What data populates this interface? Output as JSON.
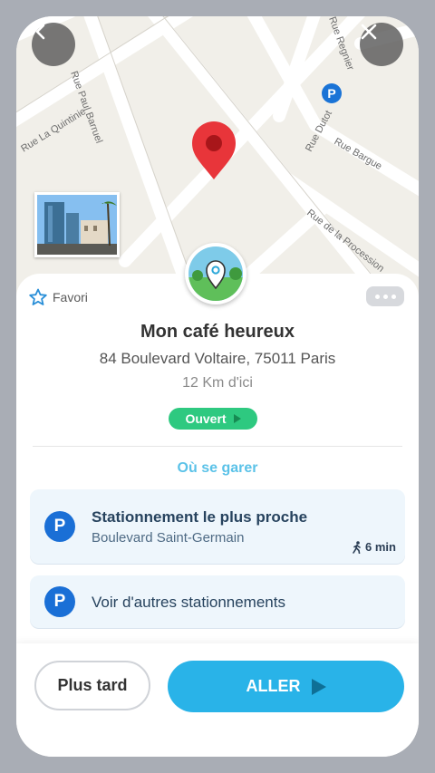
{
  "map": {
    "streets": [
      "Rue La Quintinie",
      "Rue Paul Barruel",
      "Rue Dutot",
      "Rue Bargue",
      "Rue de la Procession",
      "Rue Regnier"
    ],
    "parking_marker": "P"
  },
  "buttons": {
    "back_icon": "chevron-left-icon",
    "close_icon": "close-icon"
  },
  "place": {
    "favorite_label": "Favori",
    "name": "Mon café heureux",
    "address": "84 Boulevard Voltaire, 75011 Paris",
    "distance": "12 Km d'ici",
    "status": "Ouvert",
    "status_color": "#2ec980"
  },
  "parking": {
    "section_title": "Où se garer",
    "icon_letter": "P",
    "nearest": {
      "name": "Stationnement le plus proche",
      "street": "Boulevard Saint-Germain",
      "walk": "6 min"
    },
    "other_label": "Voir d'autres stationnements"
  },
  "actions": {
    "later_label": "Plus tard",
    "go_label": "ALLER",
    "go_color": "#29b3e8"
  },
  "colors": {
    "accent": "#29b3e8",
    "pin": "#e8353a",
    "parking": "#1a6fd6"
  }
}
